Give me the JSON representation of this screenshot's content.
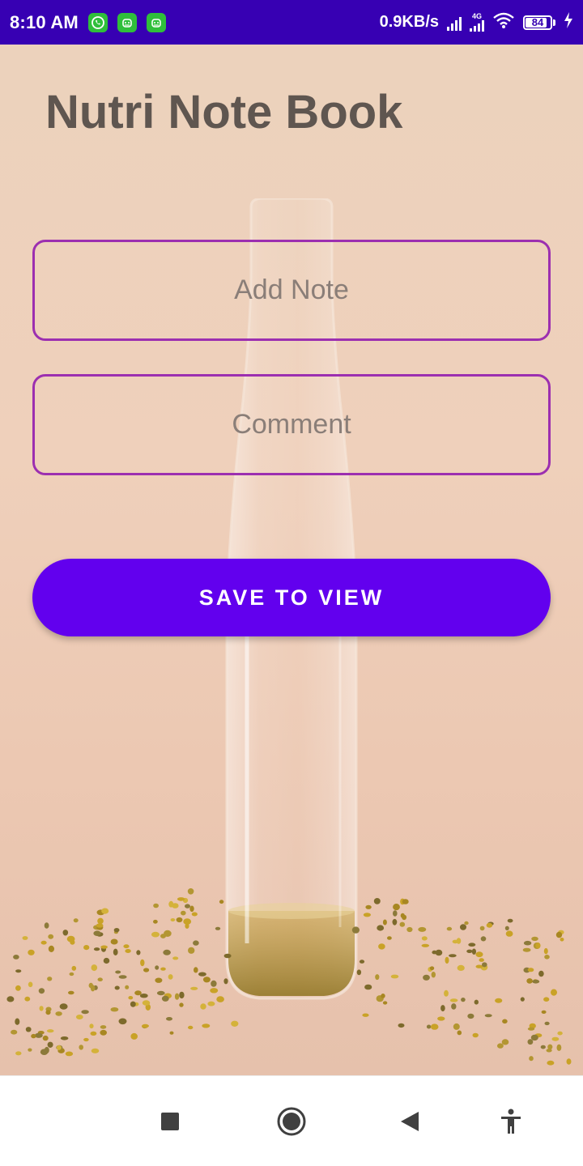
{
  "status_bar": {
    "time": "8:10 AM",
    "network_speed": "0.9KB/s",
    "network_type": "4G",
    "battery": "84",
    "notification_icons": [
      "whatsapp-icon",
      "android-icon",
      "android-icon"
    ],
    "background_color": "#3700b3"
  },
  "app": {
    "title": "Nutri Note Book",
    "note_input": {
      "placeholder": "Add Note",
      "value": ""
    },
    "comment_input": {
      "placeholder": "Comment",
      "value": ""
    },
    "save_button_label": "SAVE TO VIEW",
    "accent_color": "#6200ee",
    "input_border_color": "#9c2fb0"
  },
  "navigation_bar": {
    "buttons": [
      "recents-icon",
      "home-icon",
      "back-icon",
      "accessibility-icon"
    ]
  }
}
